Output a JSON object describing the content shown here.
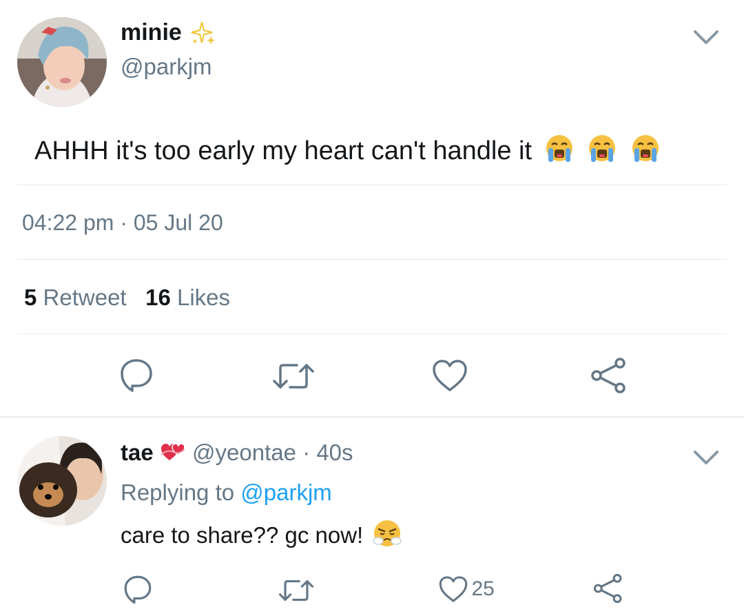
{
  "main_tweet": {
    "display_name": "minie",
    "name_emoji": "sparkles-emoji",
    "handle": "@parkjm",
    "text": "AHHH it's too early my heart can't handle it",
    "text_emojis": [
      "loudly-crying-face-emoji",
      "loudly-crying-face-emoji",
      "loudly-crying-face-emoji"
    ],
    "timestamp": "04:22 pm · 05 Jul 20",
    "retweet_count": "5",
    "retweet_label": "Retweet",
    "like_count": "16",
    "like_label": "Likes"
  },
  "reply_tweet": {
    "display_name": "tae",
    "name_emoji": "heart-with-ribbon-emoji",
    "handle": "@yeontae",
    "separator": "·",
    "age": "40s",
    "replying_label": "Replying to",
    "replying_to": "@parkjm",
    "text": "care to share?? gc now!",
    "text_emoji": "face-with-steam-emoji",
    "like_count": "25"
  },
  "colors": {
    "text": "#14171a",
    "secondary": "#657786",
    "link": "#1da1f2",
    "divider": "#e1e8ed"
  },
  "icons": [
    "reply-icon",
    "retweet-icon",
    "like-icon",
    "share-icon",
    "chevron-down-icon"
  ]
}
